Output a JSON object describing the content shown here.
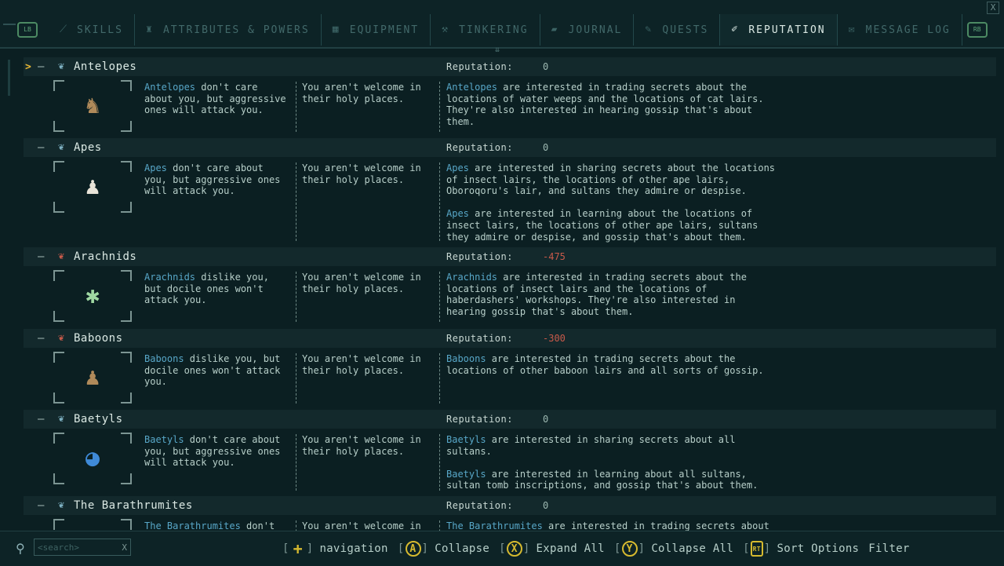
{
  "window": {
    "close_label": "X"
  },
  "tabs": [
    {
      "label": "SKILLS",
      "icon": "sword-icon",
      "active": false
    },
    {
      "label": "ATTRIBUTES & POWERS",
      "icon": "figure-icon",
      "active": false
    },
    {
      "label": "EQUIPMENT",
      "icon": "grid-icon",
      "active": false
    },
    {
      "label": "TINKERING",
      "icon": "wrench-icon",
      "active": false
    },
    {
      "label": "JOURNAL",
      "icon": "book-icon",
      "active": false
    },
    {
      "label": "QUESTS",
      "icon": "quill-icon",
      "active": false
    },
    {
      "label": "REPUTATION",
      "icon": "scroll-icon",
      "active": true
    },
    {
      "label": "MESSAGE LOG",
      "icon": "envelope-icon",
      "active": false
    }
  ],
  "tab_buttons": {
    "left": "LB",
    "right": "RB"
  },
  "reputation_label": "Reputation:",
  "holy_places_text": "You aren't welcome in their holy places.",
  "factions": [
    {
      "name": "Antelopes",
      "reputation": "0",
      "hostile": false,
      "attitude_name": "Antelopes",
      "attitude_rest": " don't care about you, but aggressive ones will attack you.",
      "holy": "You aren't welcome in their holy places.",
      "interests": [
        {
          "name": "Antelopes",
          "rest": " are interested in trading secrets about the locations of water weeps and the locations of cat lairs. They're also interested in hearing gossip that's about them."
        }
      ]
    },
    {
      "name": "Apes",
      "reputation": "0",
      "hostile": false,
      "attitude_name": "Apes",
      "attitude_rest": " don't care about you, but aggressive ones will attack you.",
      "holy": "You aren't welcome in their holy places.",
      "interests": [
        {
          "name": "Apes",
          "rest": " are interested in sharing secrets about the locations of insect lairs, the locations of other ape lairs, Oboroqoru's lair, and sultans they admire or despise."
        },
        {
          "name": "Apes",
          "rest": " are interested in learning about the locations of insect lairs, the locations of other ape lairs, sultans they admire or despise, and gossip that's about them."
        }
      ]
    },
    {
      "name": "Arachnids",
      "reputation": "-475",
      "hostile": true,
      "attitude_name": "Arachnids",
      "attitude_rest": " dislike you, but docile ones won't attack you.",
      "holy": "You aren't welcome in their holy places.",
      "interests": [
        {
          "name": "Arachnids",
          "rest": " are interested in trading secrets about the locations of insect lairs and the locations of haberdashers' workshops. They're also interested in hearing gossip that's about them."
        }
      ]
    },
    {
      "name": "Baboons",
      "reputation": "-300",
      "hostile": true,
      "attitude_name": "Baboons",
      "attitude_rest": " dislike you, but docile ones won't attack you.",
      "holy": "You aren't welcome in their holy places.",
      "interests": [
        {
          "name": "Baboons",
          "rest": " are interested in trading secrets about the locations of other baboon lairs and all sorts of gossip."
        }
      ]
    },
    {
      "name": "Baetyls",
      "reputation": "0",
      "hostile": false,
      "attitude_name": "Baetyls",
      "attitude_rest": " don't care about you, but aggressive ones will attack you.",
      "holy": "You aren't welcome in their holy places.",
      "interests": [
        {
          "name": "Baetyls",
          "rest": " are interested in sharing secrets about all sultans."
        },
        {
          "name": "Baetyls",
          "rest": " are interested in learning about all sultans, sultan tomb inscriptions, and gossip that's about them."
        }
      ]
    },
    {
      "name": "The Barathrumites",
      "reputation": "0",
      "hostile": false,
      "attitude_name": "The Barathrumites",
      "attitude_rest": " don't",
      "holy": "You aren't welcome in",
      "interests": [
        {
          "name": "The Barathrumites",
          "rest": " are interested in trading secrets about"
        }
      ]
    }
  ],
  "search": {
    "placeholder": "<search>",
    "clear": "X"
  },
  "hints": [
    {
      "icon": "dpad-icon",
      "key": "+",
      "label": "navigation"
    },
    {
      "icon": "a-button-icon",
      "key": "A",
      "label": "Collapse"
    },
    {
      "icon": "x-button-icon",
      "key": "X",
      "label": "Expand All"
    },
    {
      "icon": "y-button-icon",
      "key": "Y",
      "label": "Collapse All"
    },
    {
      "icon": "rt-button-icon",
      "key": "RT",
      "label": "Sort Options"
    }
  ],
  "filter_label": "Filter",
  "colors": {
    "accent": "#58a7c8",
    "hostile": "#c85a4a",
    "selection": "#e7b734",
    "button": "#d6ba2f"
  }
}
